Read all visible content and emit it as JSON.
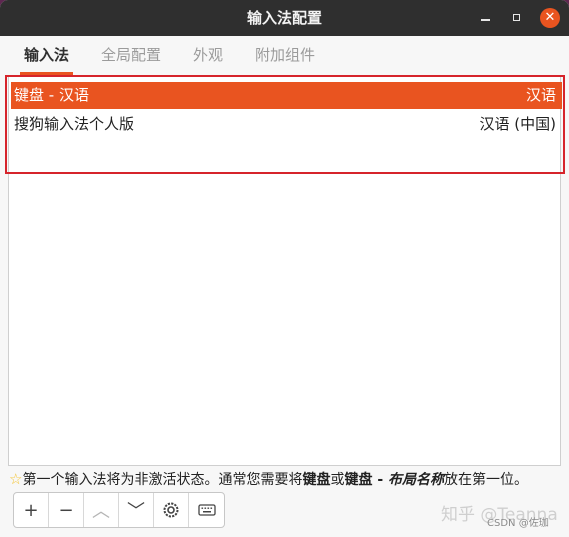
{
  "window": {
    "title": "输入法配置"
  },
  "tabs": [
    {
      "label": "输入法",
      "active": true
    },
    {
      "label": "全局配置",
      "active": false
    },
    {
      "label": "外观",
      "active": false
    },
    {
      "label": "附加组件",
      "active": false
    }
  ],
  "input_methods": [
    {
      "name": "键盘 - 汉语",
      "language": "汉语",
      "selected": true
    },
    {
      "name": "搜狗输入法个人版",
      "language": "汉语 (中国)",
      "selected": false
    }
  ],
  "hint": {
    "part1": "第一个输入法将为非激活状态。通常您需要将",
    "bold1": "键盘",
    "part2": "或",
    "bold2": "键盘 - ",
    "italic_bold": "布局名称",
    "part3": "放在第一位。"
  },
  "toolbar": {
    "add": "+",
    "remove": "−",
    "up": "︿",
    "down": "﹀",
    "configure_icon": "gear-icon",
    "keyboard_icon": "keyboard-icon"
  },
  "watermark": {
    "text": "知乎 @Teanna",
    "sub": "CSDN @佐珈"
  },
  "colors": {
    "accent": "#e95420",
    "highlight_border": "#d6242b"
  }
}
